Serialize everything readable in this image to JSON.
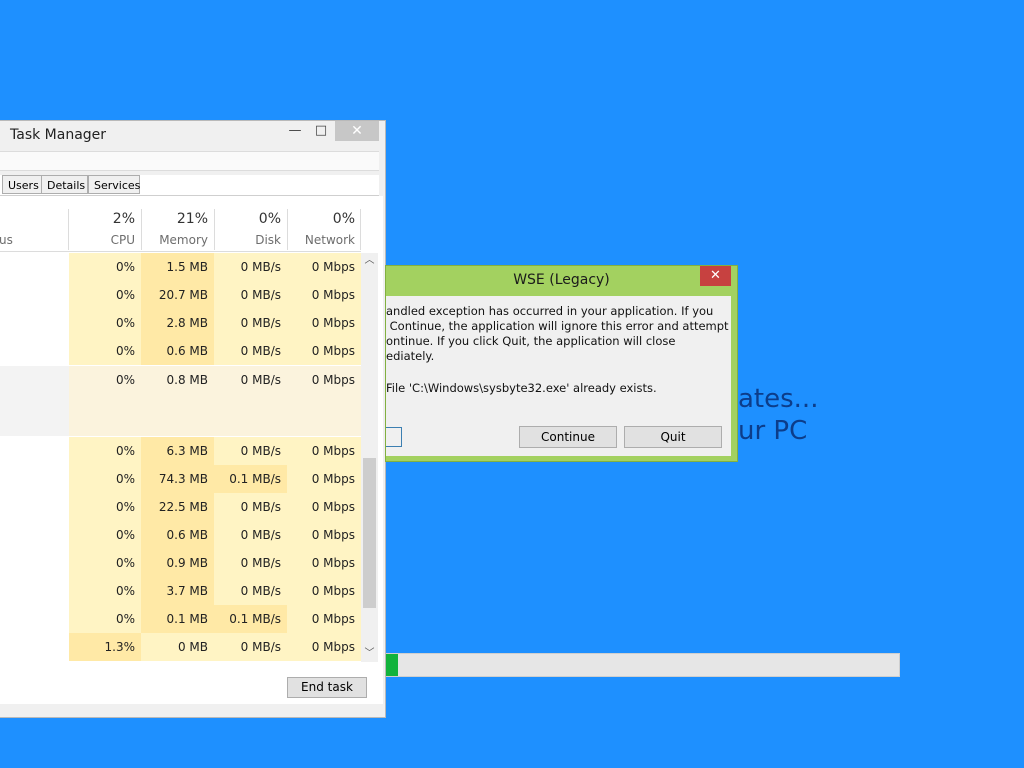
{
  "background": {
    "line1": "ates...",
    "line2": "ur PC",
    "progress": 0.023
  },
  "task_manager": {
    "title": "Task Manager",
    "window_buttons": {
      "minimize": "—",
      "maximize": "□",
      "close": "✕"
    },
    "tabs": [
      "Users",
      "Details",
      "Services"
    ],
    "header": {
      "name_fragment": "us",
      "columns": [
        {
          "pct": "2%",
          "label": "CPU"
        },
        {
          "pct": "21%",
          "label": "Memory"
        },
        {
          "pct": "0%",
          "label": "Disk"
        },
        {
          "pct": "0%",
          "label": "Network"
        }
      ]
    },
    "rows": [
      {
        "cpu": "0%",
        "mem": "1.5 MB",
        "disk": "0 MB/s",
        "net": "0 Mbps"
      },
      {
        "cpu": "0%",
        "mem": "20.7 MB",
        "disk": "0 MB/s",
        "net": "0 Mbps"
      },
      {
        "cpu": "0%",
        "mem": "2.8 MB",
        "disk": "0 MB/s",
        "net": "0 Mbps"
      },
      {
        "cpu": "0%",
        "mem": "0.6 MB",
        "disk": "0 MB/s",
        "net": "0 Mbps"
      },
      {
        "cpu": "0%",
        "mem": "0.8 MB",
        "disk": "0 MB/s",
        "net": "0 Mbps"
      },
      {
        "cpu": "0%",
        "mem": "6.3 MB",
        "disk": "0 MB/s",
        "net": "0 Mbps"
      },
      {
        "cpu": "0%",
        "mem": "74.3 MB",
        "disk": "0.1 MB/s",
        "net": "0 Mbps"
      },
      {
        "cpu": "0%",
        "mem": "22.5 MB",
        "disk": "0 MB/s",
        "net": "0 Mbps"
      },
      {
        "cpu": "0%",
        "mem": "0.6 MB",
        "disk": "0 MB/s",
        "net": "0 Mbps"
      },
      {
        "cpu": "0%",
        "mem": "0.9 MB",
        "disk": "0 MB/s",
        "net": "0 Mbps"
      },
      {
        "cpu": "0%",
        "mem": "3.7 MB",
        "disk": "0 MB/s",
        "net": "0 Mbps"
      },
      {
        "cpu": "0%",
        "mem": "0.1 MB",
        "disk": "0.1 MB/s",
        "net": "0 Mbps"
      },
      {
        "cpu": "1.3%",
        "mem": "0 MB",
        "disk": "0 MB/s",
        "net": "0 Mbps"
      }
    ],
    "end_task_label": "End task"
  },
  "dialog": {
    "title": "WSE (Legacy)",
    "close": "✕",
    "message_lines": [
      "andled exception has occurred in your application. If you",
      " Continue, the application will ignore this error and attempt",
      "ontinue. If you click Quit, the application will close",
      "ediately."
    ],
    "file_message": "File 'C:\\Windows\\sysbyte32.exe' already exists.",
    "continue_label": "Continue",
    "quit_label": "Quit"
  }
}
